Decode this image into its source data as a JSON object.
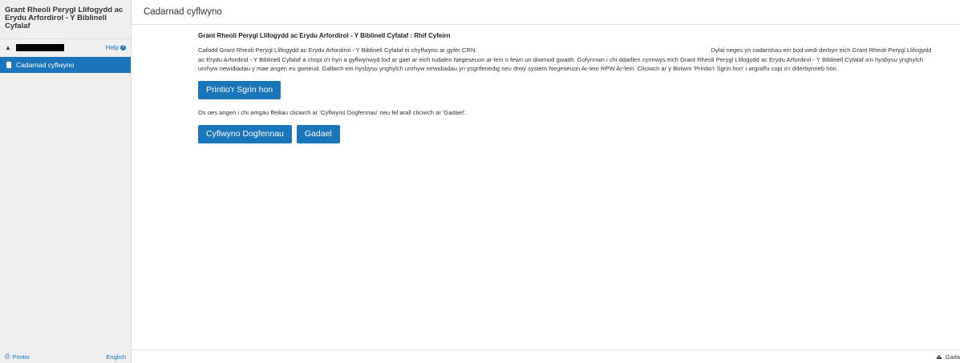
{
  "sidebar": {
    "title": "Grant Rheoli Perygl Llifogydd ac Erydu Arfordirol - Y Biblinell Cyfalaf",
    "help_label": "Help",
    "nav_items": [
      {
        "label": "Cadarnad cyflwyno"
      }
    ],
    "footer": {
      "print_label": "Printio",
      "language_label": "English"
    }
  },
  "topbar": {
    "title": "Cadarnad cyflwyno"
  },
  "main": {
    "heading": "Grant Rheoli Perygl Llifogydd ac Erydu Arfordirol - Y Biblinell Cyfalaf : Rhif Cyfeirn",
    "para1_a": "Cafodd Grant Rheoli Perygl Llifogydd ac Erydu Arfordirol - Y Biblinell Cyfalaf ei chyflwyno ar gyfer CRN:",
    "para1_b": "Dylai neges yn cadarnhau ein bod wedi derbyn eich Grant Rheoli Perygl Llifogydd ac Erydu Arfordirol - Y Biblinell Cyfalaf a chopi o'r hyn a gyflwynwyd fod ar gael ar eich tudalen Negeseuon ar-lein o fewn un diwrnod gwaith. Gofynnwn i chi ddarllen cynnwys eich Grant Rheoli Perygl Llifogydd ac Erydu Arfordirol - Y Biblinell Cyfalaf a'n hysbysu ynghylch unrhyw newidiadau y mae angen eu gwneud. Gallwch ein hysbysu ynghylch unrhyw newidiadau yn ysgrifenedig neu drwy system Negeseuon Ar-lein RPW Ar-lein. Cliciwch ar y Botwm 'Printio'r Sgrin hon' i argraffu copi o'r dderbynneb hon.",
    "print_button": "Printio'r Sgrin hon",
    "para2": "Os oes angen i chi amgáu ffeiliau cliciwch ar 'Cyflwyno Dogfennau' neu fel arall cliciwch ar 'Gadael'.",
    "submit_docs_button": "Cyflwyno Dogfennau",
    "exit_button": "Gadael"
  },
  "footer": {
    "exit_label": "Gada"
  },
  "colors": {
    "accent": "#1a75bb",
    "sidebar_bg": "#efefef"
  },
  "icons": {
    "user": "user-icon",
    "help": "question-circle-icon",
    "document": "document-icon",
    "print": "printer-icon",
    "exit": "eject-icon"
  }
}
